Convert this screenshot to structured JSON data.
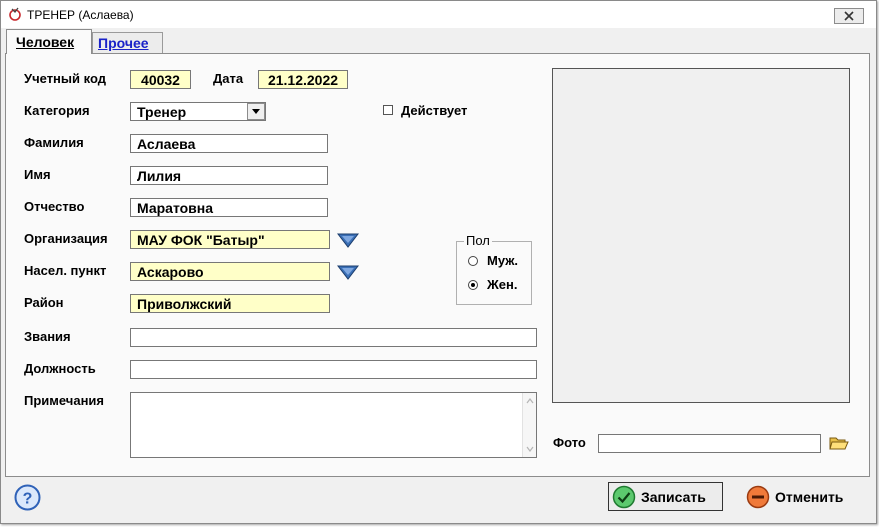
{
  "window": {
    "title": "ТРЕНЕР  (Аслаева)"
  },
  "tabs": [
    {
      "label": "Человек",
      "active": true
    },
    {
      "label": "Прочее",
      "active": false
    }
  ],
  "form": {
    "account_code_label": "Учетный код",
    "account_code_value": "40032",
    "date_label": "Дата",
    "date_value": "21.12.2022",
    "category_label": "Категория",
    "category_value": "Тренер",
    "active_label": "Действует",
    "active_checked": false,
    "surname_label": "Фамилия",
    "surname_value": "Аслаева",
    "name_label": "Имя",
    "name_value": "Лилия",
    "patronymic_label": "Отчество",
    "patronymic_value": "Маратовна",
    "organization_label": "Организация",
    "organization_value": "МАУ ФОК \"Батыр\"",
    "locality_label": "Насел. пункт",
    "locality_value": "Аскарово",
    "district_label": "Район",
    "district_value": "Приволжский",
    "titles_label": "Звания",
    "titles_value": "",
    "position_label": "Должность",
    "position_value": "",
    "notes_label": "Примечания",
    "notes_value": "",
    "gender": {
      "group_label": "Пол",
      "options": [
        {
          "label": "Муж.",
          "selected": false
        },
        {
          "label": "Жен.",
          "selected": true
        }
      ]
    },
    "photo_label": "Фото",
    "photo_value": ""
  },
  "buttons": {
    "save_label": "Записать",
    "cancel_label": "Отменить"
  },
  "icons": {
    "title": "app-icon",
    "close": "close-icon",
    "dropdown": "chevron-down-icon",
    "lookup": "triangle-down-icon",
    "folder": "folder-icon",
    "help": "help-icon",
    "save": "check-icon",
    "cancel": "minus-icon"
  },
  "colors": {
    "required_field_bg": "#ffffc8",
    "lookup_icon": "#3a6fb6",
    "link_tab": "#1a22c8",
    "save_icon": "#2fa84a",
    "cancel_icon": "#e05a22",
    "help_icon": "#2f62b8"
  }
}
